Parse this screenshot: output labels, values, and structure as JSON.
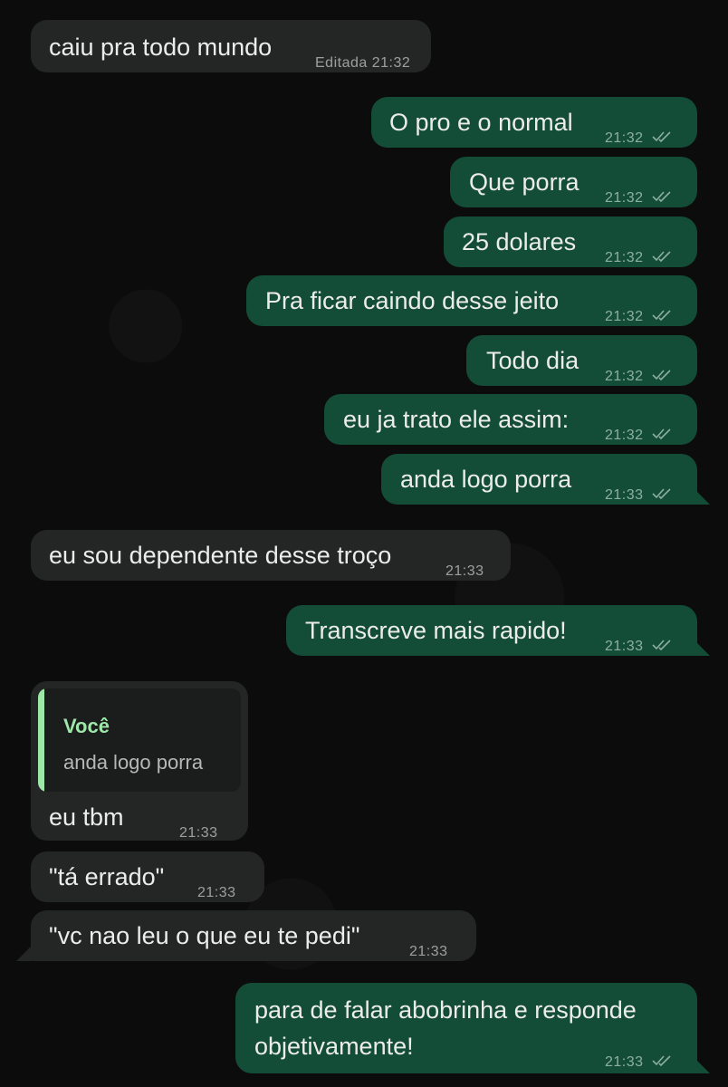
{
  "messages": [
    {
      "text": "caiu pra todo mundo",
      "edited": "Editada",
      "time": "21:32"
    },
    {
      "text": "O pro e o normal",
      "time": "21:32"
    },
    {
      "text": "Que porra",
      "time": "21:32"
    },
    {
      "text": "25 dolares",
      "time": "21:32"
    },
    {
      "text": "Pra ficar caindo desse jeito",
      "time": "21:32"
    },
    {
      "text": "Todo dia",
      "time": "21:32"
    },
    {
      "text": "eu ja trato ele assim:",
      "time": "21:32"
    },
    {
      "text": "anda logo porra",
      "time": "21:33"
    },
    {
      "text": "eu sou dependente desse troço",
      "time": "21:33"
    },
    {
      "text": "Transcreve mais rapido!",
      "time": "21:33"
    },
    {
      "text": "eu tbm",
      "time": "21:33",
      "quote": {
        "author": "Você",
        "text": "anda logo porra"
      }
    },
    {
      "text": "\"tá errado\"",
      "time": "21:33"
    },
    {
      "text": "\"vc nao leu o que eu te pedi\"",
      "time": "21:33"
    },
    {
      "text_line1": "para de falar abobrinha e responde",
      "text_line2": "objetivamente!",
      "time": "21:33"
    }
  ],
  "colors": {
    "incoming_bubble": "#242626",
    "outgoing_bubble": "#134d37",
    "quote_accent": "#9de8a8"
  },
  "icons": {
    "read_receipt": "double-check-icon"
  }
}
